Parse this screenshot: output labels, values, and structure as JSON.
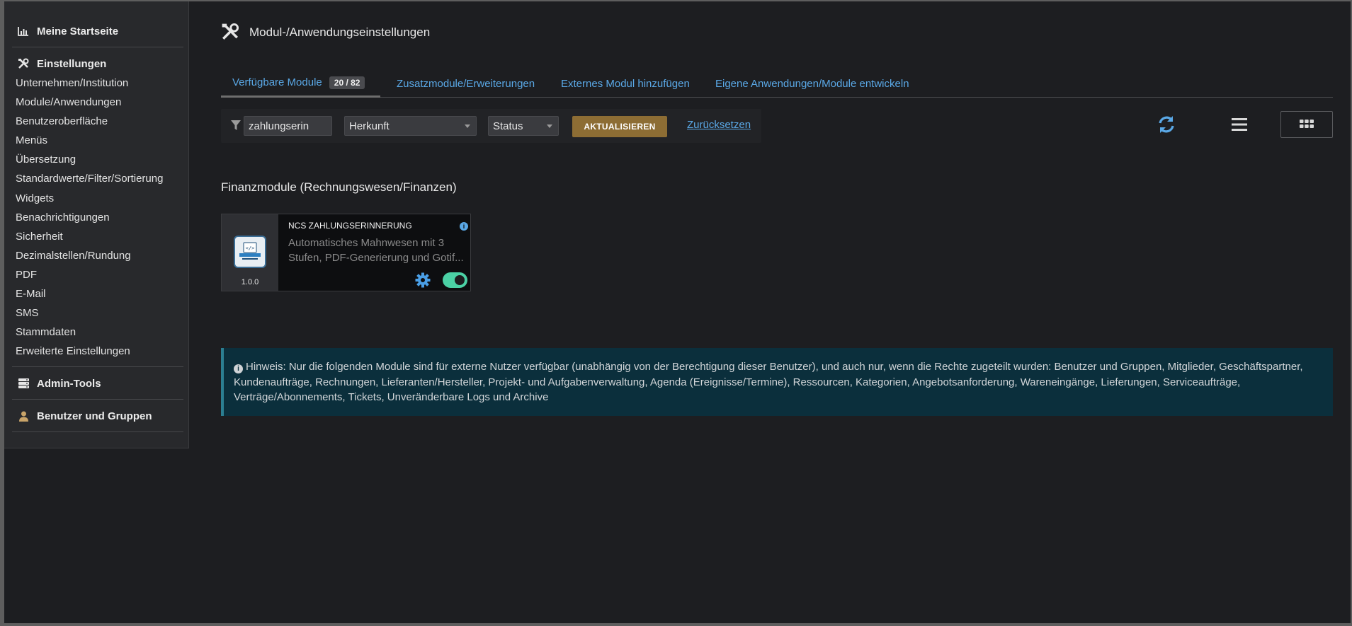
{
  "sidebar": {
    "home": "Meine Startseite",
    "settings": "Einstellungen",
    "items": [
      "Unternehmen/Institution",
      "Module/Anwendungen",
      "Benutzeroberfläche",
      "Menüs",
      "Übersetzung",
      "Standardwerte/Filter/Sortierung",
      "Widgets",
      "Benachrichtigungen",
      "Sicherheit",
      "Dezimalstellen/Rundung",
      "PDF",
      "E-Mail",
      "SMS",
      "Stammdaten",
      "Erweiterte Einstellungen"
    ],
    "admin_tools": "Admin-Tools",
    "users_groups": "Benutzer und Gruppen"
  },
  "header": {
    "title": "Modul-/Anwendungseinstellungen"
  },
  "tabs": [
    {
      "label": "Verfügbare Module",
      "badge": "20 / 82",
      "active": true
    },
    {
      "label": "Zusatzmodule/Erweiterungen"
    },
    {
      "label": "Externes Modul hinzufügen"
    },
    {
      "label": "Eigene Anwendungen/Module entwickeln"
    }
  ],
  "filter": {
    "search_value": "zahlungserin",
    "origin": "Herkunft",
    "status": "Status",
    "update_label": "AKTUALISIEREN",
    "reset_label": "Zurücksetzen"
  },
  "section": {
    "title": "Finanzmodule (Rechnungswesen/Finanzen)"
  },
  "module_card": {
    "name": "NCS ZAHLUNGSERINNERUNG",
    "description_line1": "Automatisches Mahnwesen mit 3",
    "description_line2": "Stufen, PDF-Generierung und Gotif...",
    "version": "1.0.0",
    "enabled": true
  },
  "notice": {
    "text": "Hinweis: Nur die folgenden Module sind für externe Nutzer verfügbar (unabhängig von der Berechtigung dieser Benutzer), und auch nur, wenn die Rechte zugeteilt wurden: Benutzer und Gruppen, Mitglieder, Geschäftspartner, Kundenaufträge, Rechnungen, Lieferanten/Hersteller, Projekt- und Aufgabenverwaltung, Agenda (Ereignisse/Termine), Ressourcen, Kategorien, Angebotsanforderung, Wareneingänge, Lieferungen, Serviceaufträge, Verträge/Abonnements, Tickets, Unveränderbare Logs und Archive"
  },
  "colors": {
    "accent": "#5aa8e6",
    "button": "#8d6d34",
    "toggle_on": "#4bd1a5",
    "notice_bg": "#0b2f3c"
  },
  "icons": {
    "home": "chart-icon",
    "settings": "tools-icon",
    "admin": "server-icon",
    "users": "user-icon",
    "filter": "filter-icon",
    "refresh": "refresh-icon",
    "list": "list-icon",
    "grid": "grid-icon"
  }
}
